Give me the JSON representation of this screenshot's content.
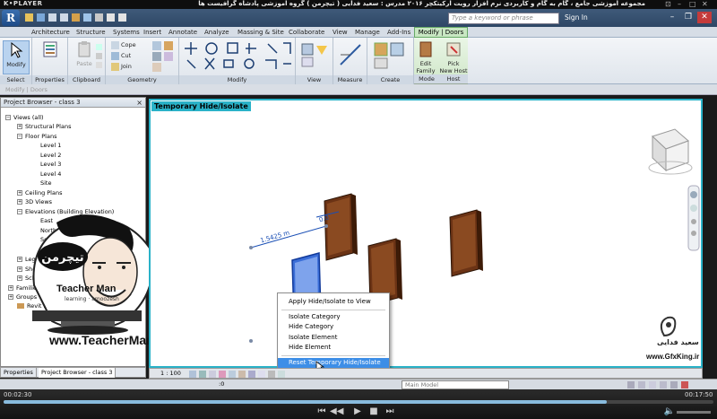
{
  "player": {
    "logo": "K•PLAYER",
    "title": "مجموعه آموزشی جامع ، گام به گام و کاربردی نرم افزار رویت آرکیتکچر ۲۰۱۶   مدرس : سعید فدایی ( تیچرمن ) گروه آموزشی پادشاه گرافیست ها",
    "elapsed": "00:02:30",
    "total": "00:17:50",
    "progress": 0.85
  },
  "revit": {
    "app_letter": "R",
    "search_placeholder": "Type a keyword or phrase",
    "sign_in": "Sign In",
    "tabs": [
      "Architecture",
      "Structure",
      "Systems",
      "Insert",
      "Annotate",
      "Analyze",
      "Massing & Site",
      "Collaborate",
      "View",
      "Manage",
      "Add-Ins"
    ],
    "active_tab": "Modify | Doors",
    "ribbon": {
      "modify": "Modify",
      "select": "Select",
      "properties": "Properties",
      "paste": "Paste",
      "clipboard": "Clipboard",
      "cope": "Cope",
      "cut": "Cut",
      "join": "Join",
      "geometry": "Geometry",
      "modify_panel": "Modify",
      "view": "View",
      "measure": "Measure",
      "create": "Create",
      "edit_family_1": "Edit",
      "edit_family_2": "Family",
      "mode": "Mode",
      "pick_host_1": "Pick",
      "pick_host_2": "New Host",
      "host": "Host"
    },
    "options_bar": "Modify | Doors"
  },
  "browser": {
    "title": "Project Browser - class 3",
    "close": "×",
    "items": [
      {
        "label": "Views (all)",
        "tog": "−"
      },
      {
        "label": "Structural Plans",
        "tog": "+"
      },
      {
        "label": "Floor Plans",
        "tog": "−"
      },
      {
        "label": "Level 1",
        "tog": ""
      },
      {
        "label": "Level 2",
        "tog": ""
      },
      {
        "label": "Level 3",
        "tog": ""
      },
      {
        "label": "Level 4",
        "tog": ""
      },
      {
        "label": "Site",
        "tog": ""
      },
      {
        "label": "Ceiling Plans",
        "tog": "+"
      },
      {
        "label": "3D Views",
        "tog": "+"
      },
      {
        "label": "Elevations (Building Elevation)",
        "tog": "−"
      },
      {
        "label": "East",
        "tog": ""
      },
      {
        "label": "North",
        "tog": ""
      },
      {
        "label": "South",
        "tog": ""
      },
      {
        "label": "Legends",
        "tog": "+"
      },
      {
        "label": "Sheets",
        "tog": "+"
      },
      {
        "label": "Schedules",
        "tog": "+"
      },
      {
        "label": "Families",
        "tog": "+"
      },
      {
        "label": "Groups",
        "tog": "+"
      },
      {
        "label": "Revit Links",
        "tog": ""
      }
    ],
    "tabs": [
      "Properties",
      "Project Browser - class 3"
    ]
  },
  "view": {
    "label": "Temporary Hide/Isolate",
    "scale": "1 : 100",
    "dimension": "1.5425 m",
    "dimension2": "0.0"
  },
  "context_menu": {
    "items": [
      "Apply Hide/Isolate to View",
      "Isolate Category",
      "Hide Category",
      "Isolate Element",
      "Hide Element",
      "Reset Temporary Hide/Isolate"
    ],
    "highlighted": 5
  },
  "status": {
    "model": "Main Model",
    "zero": ":0"
  },
  "branding": {
    "teacherman_fa": "تیچرمن",
    "teacherman_en": "Teacher Man",
    "teacherman_sub": "learning · amoozesh",
    "url": "www.TeacherMan.ir",
    "gfx_author": "سعید فدایی",
    "gfx_url": "www.GfxKing.ir"
  },
  "colors": {
    "accent": "#2ab2c8",
    "highlight": "#3d8ee7",
    "door_brown": "#6b3315",
    "door_blue": "#3b6ed8"
  }
}
